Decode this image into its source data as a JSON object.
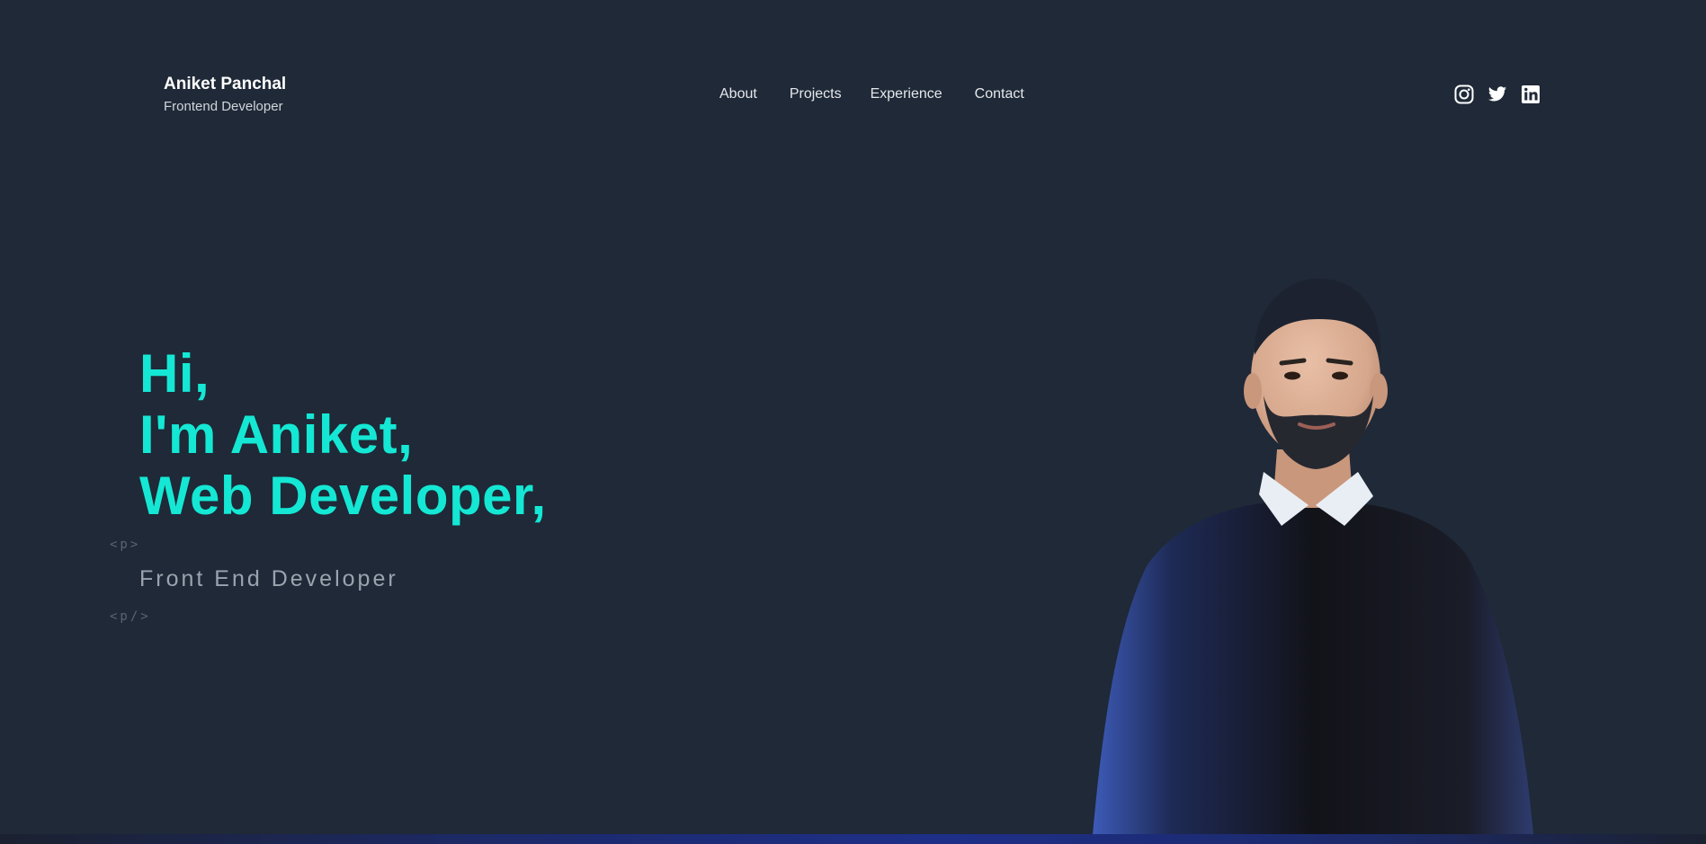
{
  "brand": {
    "name": "Aniket Panchal",
    "role": "Frontend Developer"
  },
  "nav": {
    "items": [
      "About",
      "Projects",
      "Experience",
      "Contact"
    ]
  },
  "socials": {
    "icons": [
      "instagram-icon",
      "twitter-icon",
      "linkedin-icon"
    ]
  },
  "hero": {
    "line1": "Hi,",
    "line2": "I'm Aniket,",
    "line3": "Web Developer,",
    "tag_open": "<p>",
    "subtitle": "Front End Developer",
    "tag_close": "<p/>"
  },
  "colors": {
    "background": "#1f2937",
    "accent": "#14e8d4",
    "text_light": "#e5e7eb",
    "text_muted": "#9ca3af"
  }
}
